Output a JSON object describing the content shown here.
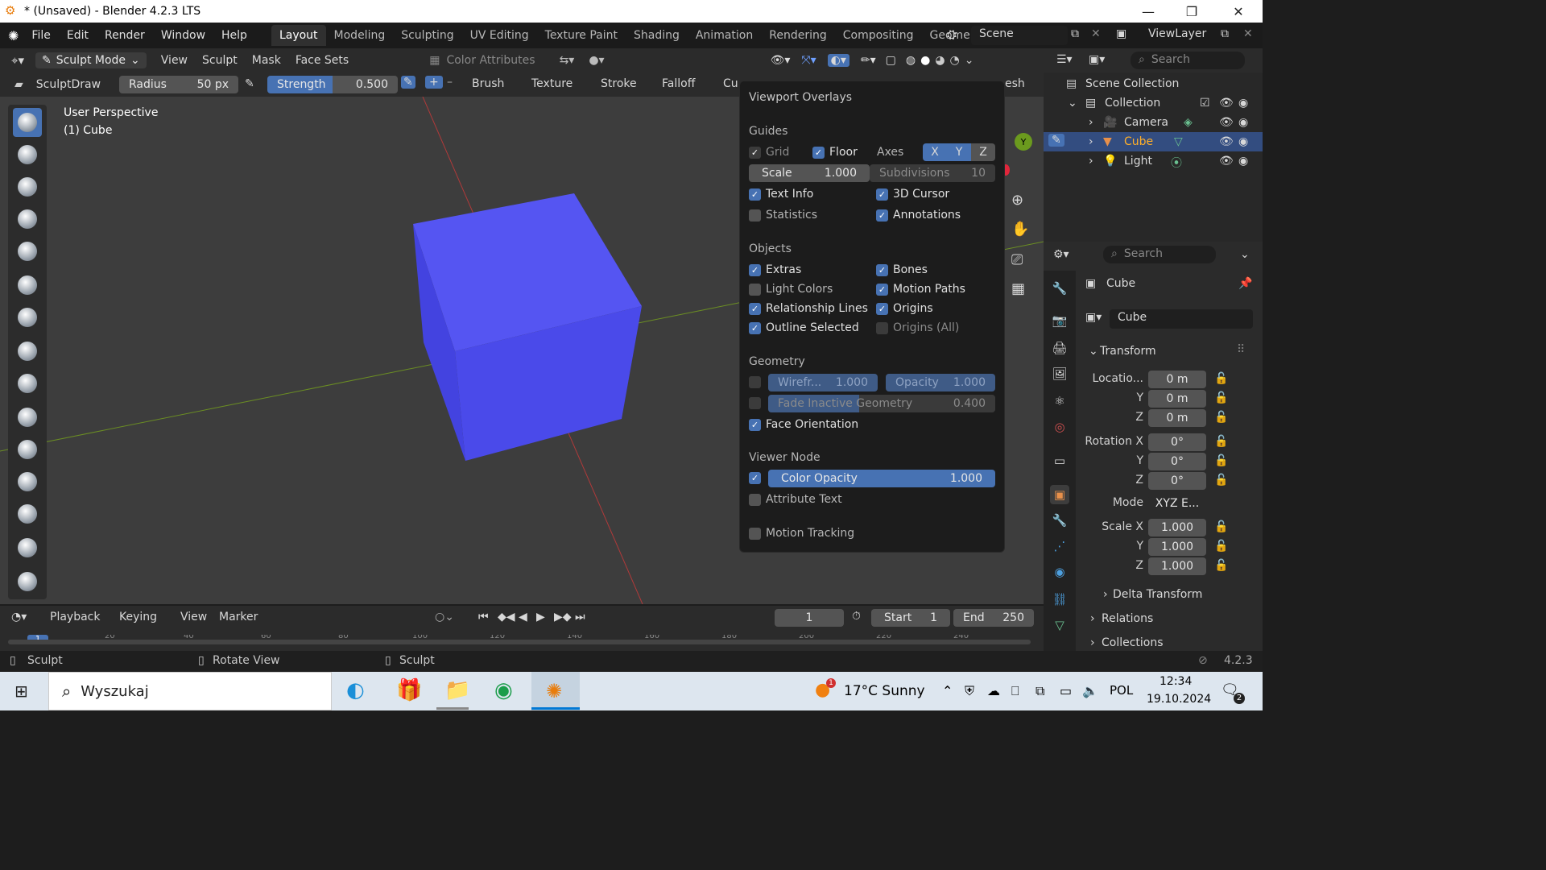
{
  "window": {
    "title": "* (Unsaved) - Blender 4.2.3 LTS",
    "minimize": "—",
    "maximize": "❐",
    "close": "✕"
  },
  "menu": [
    "File",
    "Edit",
    "Render",
    "Window",
    "Help"
  ],
  "workspaces": [
    "Layout",
    "Modeling",
    "Sculpting",
    "UV Editing",
    "Texture Paint",
    "Shading",
    "Animation",
    "Rendering",
    "Compositing",
    "Geome"
  ],
  "scene": "Scene",
  "view_layer": "ViewLayer",
  "header": {
    "mode": "Sculpt Mode",
    "menus": [
      "View",
      "Sculpt",
      "Mask",
      "Face Sets"
    ],
    "color_attributes": "Color Attributes"
  },
  "toolsettings": {
    "brush": "SculptDraw",
    "radius_label": "Radius",
    "radius_value": "50 px",
    "strength_label": "Strength",
    "strength_value": "0.500",
    "plus": "+",
    "minus": "–",
    "dropdowns": [
      "Brush",
      "Texture",
      "Stroke",
      "Falloff",
      "Cu"
    ],
    "mesh_tail": "esh"
  },
  "viewport": {
    "perspective": "User Perspective",
    "object": "(1) Cube",
    "axis_y": "Y"
  },
  "overlays": {
    "title": "Viewport Overlays",
    "guides": "Guides",
    "grid": "Grid",
    "floor": "Floor",
    "axes": "Axes",
    "x": "X",
    "y": "Y",
    "z": "Z",
    "scale_label": "Scale",
    "scale_value": "1.000",
    "subdiv_label": "Subdivisions",
    "subdiv_value": "10",
    "text_info": "Text Info",
    "cursor3d": "3D Cursor",
    "statistics": "Statistics",
    "annotations": "Annotations",
    "objects": "Objects",
    "extras": "Extras",
    "bones": "Bones",
    "light_colors": "Light Colors",
    "motion_paths": "Motion Paths",
    "relationship_lines": "Relationship Lines",
    "origins": "Origins",
    "outline_selected": "Outline Selected",
    "origins_all": "Origins (All)",
    "geometry": "Geometry",
    "wireframe_label": "Wirefr...",
    "wireframe_value": "1.000",
    "opacity_label": "Opacity",
    "opacity_value": "1.000",
    "fade_label": "Fade Inactive Geometry",
    "fade_value": "0.400",
    "face_orientation": "Face Orientation",
    "viewer_node": "Viewer Node",
    "color_opacity_label": "Color Opacity",
    "color_opacity_value": "1.000",
    "attribute_text": "Attribute Text",
    "motion_tracking": "Motion Tracking"
  },
  "outliner": {
    "search": "Search",
    "scene_collection": "Scene Collection",
    "collection": "Collection",
    "items": [
      "Camera",
      "Cube",
      "Light"
    ]
  },
  "properties": {
    "search": "Search",
    "object_name": "Cube",
    "data_name": "Cube",
    "transform": "Transform",
    "location_label": "Locatio...",
    "loc": [
      "0 m",
      "0 m",
      "0 m"
    ],
    "rotation_label": "Rotation X",
    "rot": [
      "0°",
      "0°",
      "0°"
    ],
    "mode_label": "Mode",
    "mode_value": "XYZ E...",
    "scale_label": "Scale X",
    "scale": [
      "1.000",
      "1.000",
      "1.000"
    ],
    "y": "Y",
    "z": "Z",
    "delta": "Delta Transform",
    "relations": "Relations",
    "collections": "Collections"
  },
  "timeline": {
    "menus": [
      "Playback",
      "Keying",
      "View",
      "Marker"
    ],
    "frame": "1",
    "start_label": "Start",
    "start_value": "1",
    "end_label": "End",
    "end_value": "250",
    "ticks": [
      "1",
      "20",
      "40",
      "60",
      "80",
      "100",
      "120",
      "140",
      "160",
      "180",
      "200",
      "220",
      "240"
    ]
  },
  "status": {
    "left": "Sculpt",
    "middle": "Rotate View",
    "right": "Sculpt",
    "version": "4.2.3"
  },
  "taskbar": {
    "search": "Wyszukaj",
    "weather": "17°C  Sunny",
    "weather_badge": "1",
    "lang": "POL",
    "time": "12:34",
    "date": "19.10.2024",
    "notif": "2"
  },
  "colors": {
    "accent": "#4772b3",
    "cube": "#4e4ef0",
    "selected_text": "#ffaf29"
  }
}
